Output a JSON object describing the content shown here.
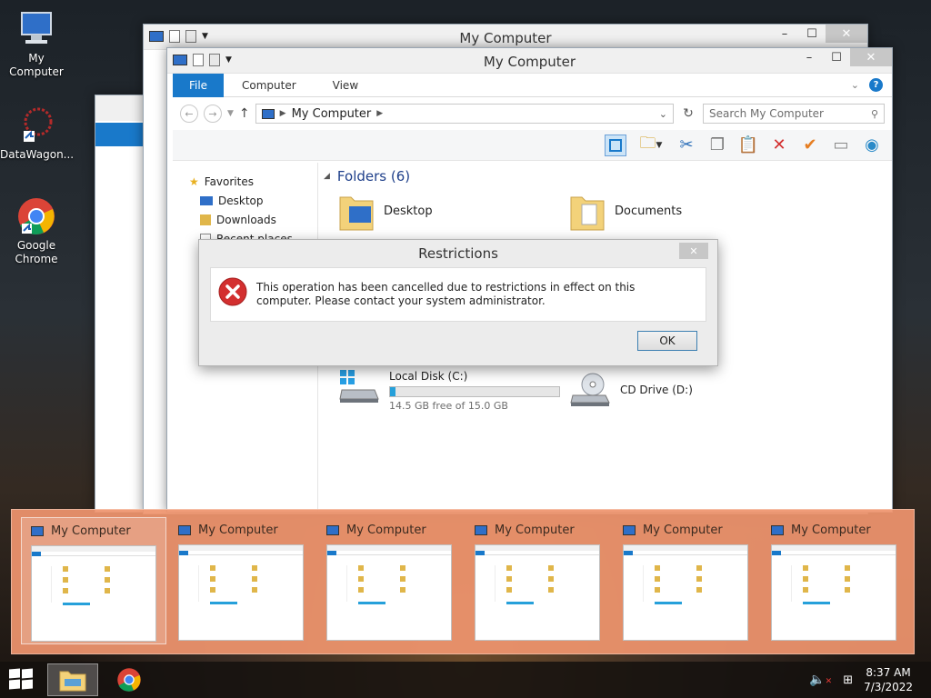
{
  "desktop": {
    "icons": [
      {
        "label": "My Computer"
      },
      {
        "label": "DataWagon..."
      },
      {
        "label": "Google Chrome"
      }
    ]
  },
  "window_back": {
    "title": "My Computer",
    "ribbon": {
      "file": "File",
      "computer": "Computer",
      "view": "View"
    },
    "address": "My Computer",
    "search_placeholder": "Search My Computer",
    "nav": {
      "favorites": "Favorites",
      "desktop": "Desktop",
      "downloads": "Downloads",
      "recent": "Recent places"
    }
  },
  "window_front": {
    "title": "My Computer",
    "ribbon": {
      "file": "File",
      "computer": "Computer",
      "view": "View"
    },
    "address": "My Computer",
    "search_placeholder": "Search My Computer",
    "nav": {
      "favorites": "Favorites",
      "desktop": "Desktop",
      "downloads": "Downloads",
      "recent": "Recent places"
    },
    "folders_header": "Folders (6)",
    "folders": [
      {
        "name": "Desktop"
      },
      {
        "name": "Documents"
      }
    ],
    "drives": [
      {
        "name": "Local Disk (C:)",
        "free": "14.5 GB free of 15.0 GB",
        "used_fraction": 0.03
      },
      {
        "name": "CD Drive (D:)"
      }
    ]
  },
  "dialog": {
    "title": "Restrictions",
    "message": "This operation has been cancelled due to restrictions in effect on this computer. Please contact your system administrator.",
    "ok_label": "OK"
  },
  "switcher": {
    "items": [
      {
        "title": "My Computer"
      },
      {
        "title": "My Computer"
      },
      {
        "title": "My Computer"
      },
      {
        "title": "My Computer"
      },
      {
        "title": "My Computer"
      },
      {
        "title": "My Computer"
      }
    ]
  },
  "taskbar": {
    "time": "8:37 AM",
    "date": "7/3/2022"
  },
  "colors": {
    "accent": "#1979ca",
    "switcher": "#ef956e",
    "error": "#d32f2f"
  }
}
